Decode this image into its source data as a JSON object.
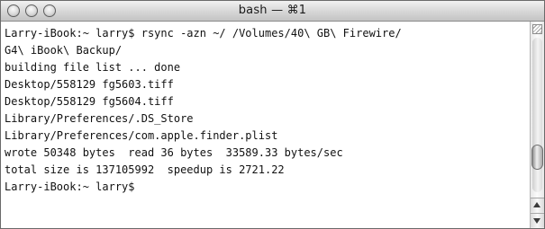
{
  "window": {
    "title": "bash — ⌘1"
  },
  "terminal": {
    "lines": [
      "Larry-iBook:~ larry$ rsync -azn ~/ /Volumes/40\\ GB\\ Firewire/",
      "G4\\ iBook\\ Backup/",
      "building file list ... done",
      "Desktop/558129 fg5603.tiff",
      "Desktop/558129 fg5604.tiff",
      "Library/Preferences/.DS_Store",
      "Library/Preferences/com.apple.finder.plist",
      "wrote 50348 bytes  read 36 bytes  33589.33 bytes/sec",
      "total size is 137105992  speedup is 2721.22",
      "Larry-iBook:~ larry$"
    ]
  },
  "colors": {
    "text": "#111111",
    "background": "#ffffff",
    "titlebar": "#d6d6d6"
  },
  "icons": {
    "close": "close-button-icon",
    "minimize": "minimize-button-icon",
    "zoom": "zoom-button-icon",
    "scroll_up": "arrow-up-icon",
    "scroll_down": "arrow-down-icon",
    "resize": "resize-handle-icon"
  }
}
